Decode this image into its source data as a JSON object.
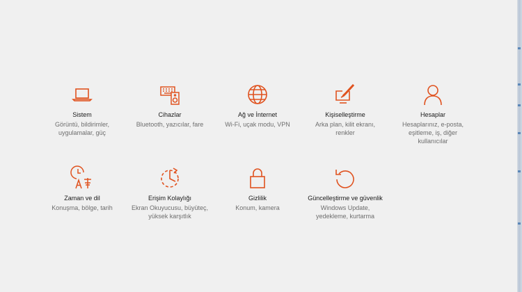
{
  "accent": "#e0521f",
  "tiles": [
    {
      "icon": "laptop-icon",
      "title": "Sistem",
      "desc": "Görüntü, bildirimler, uygulamalar, güç"
    },
    {
      "icon": "keyboard-speaker-icon",
      "title": "Cihazlar",
      "desc": "Bluetooth, yazıcılar, fare"
    },
    {
      "icon": "globe-icon",
      "title": "Ağ ve İnternet",
      "desc": "Wi-Fi, uçak modu, VPN"
    },
    {
      "icon": "paintbrush-icon",
      "title": "Kişiselleştirme",
      "desc": "Arka plan, kilit ekranı, renkler"
    },
    {
      "icon": "person-icon",
      "title": "Hesaplar",
      "desc": "Hesaplarınız, e-posta, eşitleme, iş, diğer kullanıcılar"
    },
    {
      "icon": "time-language-icon",
      "title": "Zaman ve dil",
      "desc": "Konuşma, bölge, tarih"
    },
    {
      "icon": "ease-of-access-icon",
      "title": "Erişim Kolaylığı",
      "desc": "Ekran Okuyucusu, büyüteç, yüksek karşıtlık"
    },
    {
      "icon": "lock-icon",
      "title": "Gizlilik",
      "desc": "Konum, kamera"
    },
    {
      "icon": "update-icon",
      "title": "Güncelleştirme ve güvenlik",
      "desc": "Windows Update, yedekleme, kurtarma"
    }
  ]
}
